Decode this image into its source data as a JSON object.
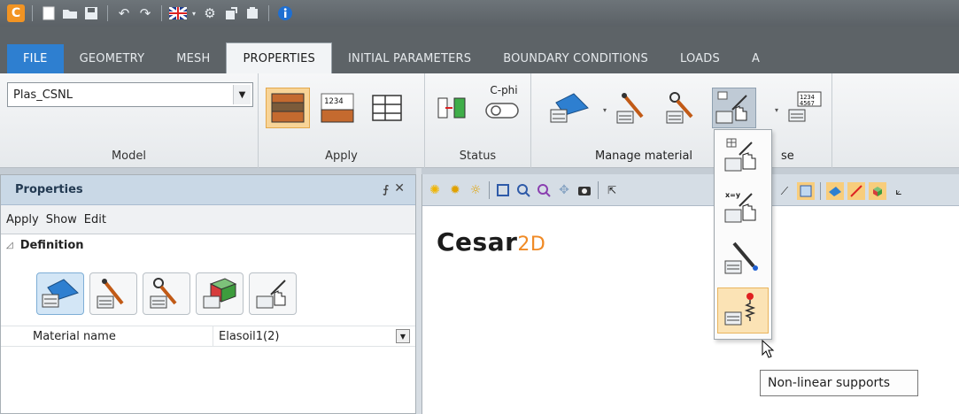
{
  "quick_access": {
    "app_logo": "C",
    "icons": [
      "new-icon",
      "open-icon",
      "save-icon",
      "undo-icon",
      "redo-icon",
      "language-flag-icon",
      "settings-icon",
      "export-icon",
      "print-icon",
      "info-icon"
    ]
  },
  "tabs": [
    {
      "label": "FILE"
    },
    {
      "label": "GEOMETRY"
    },
    {
      "label": "MESH"
    },
    {
      "label": "PROPERTIES"
    },
    {
      "label": "INITIAL PARAMETERS"
    },
    {
      "label": "BOUNDARY CONDITIONS"
    },
    {
      "label": "LOADS"
    },
    {
      "label": "A"
    }
  ],
  "ribbon": {
    "model": {
      "combo_value": "Plas_CSNL",
      "label": "Model"
    },
    "apply": {
      "label": "Apply"
    },
    "status": {
      "label": "Status",
      "cphi": "C-phi"
    },
    "manage": {
      "label": "Manage material",
      "label_tail": "se"
    },
    "number_badge": "1234\n4567"
  },
  "dropdown": {
    "items": [
      "interface-table-icon",
      "xy-interface-icon",
      "linear-support-icon",
      "non-linear-support-icon"
    ],
    "xy_label": "x=y",
    "tooltip": "Non-linear supports"
  },
  "properties": {
    "title": "Properties",
    "pin": "⨍",
    "close": "✕",
    "menu": [
      "Apply",
      "Show",
      "Edit"
    ],
    "section": "Definition",
    "row_key": "Material name",
    "row_value": "Elasoil1(2)"
  },
  "viewport": {
    "brand": "Cesar",
    "brand_suffix": "2D"
  }
}
